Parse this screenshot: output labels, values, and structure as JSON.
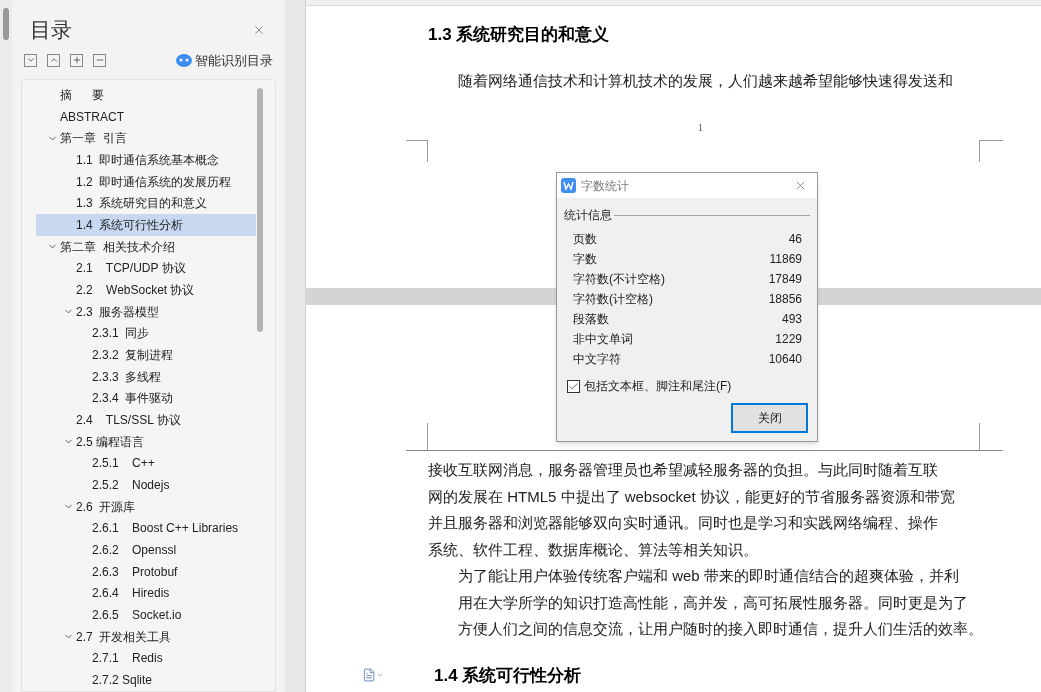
{
  "toc_panel": {
    "title": "目录",
    "smart_button": "智能识别目录",
    "items": [
      {
        "label": "摘      要",
        "selected": false
      },
      {
        "label": "ABSTRACT",
        "selected": false
      },
      {
        "label": "第一章  引言",
        "selected": false,
        "expanded": true,
        "children": [
          {
            "label": "1.1  即时通信系统基本概念",
            "selected": false
          },
          {
            "label": "1.2  即时通信系统的发展历程",
            "selected": false
          },
          {
            "label": "1.3  系统研究目的和意义",
            "selected": false
          },
          {
            "label": "1.4  系统可行性分析",
            "selected": true
          }
        ]
      },
      {
        "label": "第二章  相关技术介绍",
        "selected": false,
        "expanded": true,
        "children": [
          {
            "label": "2.1    TCP/UDP 协议",
            "selected": false
          },
          {
            "label": "2.2    WebSocket 协议",
            "selected": false
          },
          {
            "label": "2.3  服务器模型",
            "selected": false,
            "expanded": true,
            "children": [
              {
                "label": "2.3.1  同步",
                "selected": false
              },
              {
                "label": "2.3.2  复制进程",
                "selected": false
              },
              {
                "label": "2.3.3  多线程",
                "selected": false
              },
              {
                "label": "2.3.4  事件驱动",
                "selected": false
              }
            ]
          },
          {
            "label": "2.4    TLS/SSL 协议",
            "selected": false
          },
          {
            "label": "2.5 编程语言",
            "selected": false,
            "expanded": true,
            "children": [
              {
                "label": "2.5.1    C++",
                "selected": false
              },
              {
                "label": "2.5.2    Nodejs",
                "selected": false
              }
            ]
          },
          {
            "label": "2.6  开源库",
            "selected": false,
            "expanded": true,
            "children": [
              {
                "label": "2.6.1    Boost C++ Libraries",
                "selected": false
              },
              {
                "label": "2.6.2    Openssl",
                "selected": false
              },
              {
                "label": "2.6.3    Protobuf",
                "selected": false
              },
              {
                "label": "2.6.4    Hiredis",
                "selected": false
              },
              {
                "label": "2.6.5    Socket.io",
                "selected": false
              }
            ]
          },
          {
            "label": "2.7  开发相关工具",
            "selected": false,
            "expanded": true,
            "children": [
              {
                "label": "2.7.1    Redis",
                "selected": false
              },
              {
                "label": "2.7.2 Sqlite",
                "selected": false
              }
            ]
          }
        ]
      }
    ]
  },
  "document": {
    "page_1": {
      "heading": "1.3  系统研究目的和意义",
      "paragraph": [
        "随着网络通信技术和计算机技术的发展，人们越来越希望能够快速得发送和"
      ],
      "page_number": "1"
    },
    "page_2": {
      "paragraphs": [
        {
          "indent": false,
          "lines": [
            "接收互联网消息，服务器管理员也希望减轻服务器的负担。与此同时随着互联",
            "网的发展在 HTML5 中提出了 websocket 协议，能更好的节省服务器资源和带宽",
            "并且服务器和浏览器能够双向实时通讯。同时也是学习和实践网络编程、操作",
            "系统、软件工程、数据库概论、算法等相关知识。"
          ]
        },
        {
          "indent": true,
          "lines": [
            "为了能让用户体验传统客户端和 web 带来的即时通信结合的超爽体验，并利",
            "用在大学所学的知识打造高性能，高并发，高可拓展性服务器。同时更是为了",
            "方便人们之间的信息交流，让用户随时的接入即时通信，提升人们生活的效率。"
          ]
        }
      ],
      "heading": "1.4  系统可行性分析"
    }
  },
  "dialog": {
    "title": "字数统计",
    "group": "统计信息",
    "stats": [
      {
        "label": "页数",
        "value": "46"
      },
      {
        "label": "字数",
        "value": "11869"
      },
      {
        "label": "字符数(不计空格)",
        "value": "17849"
      },
      {
        "label": "字符数(计空格)",
        "value": "18856"
      },
      {
        "label": "段落数",
        "value": "493"
      },
      {
        "label": "非中文单词",
        "value": "1229"
      },
      {
        "label": "中文字符",
        "value": "10640"
      }
    ],
    "checkbox": {
      "label": "包括文本框、脚注和尾注(F)",
      "checked": true
    },
    "button": "关闭"
  }
}
